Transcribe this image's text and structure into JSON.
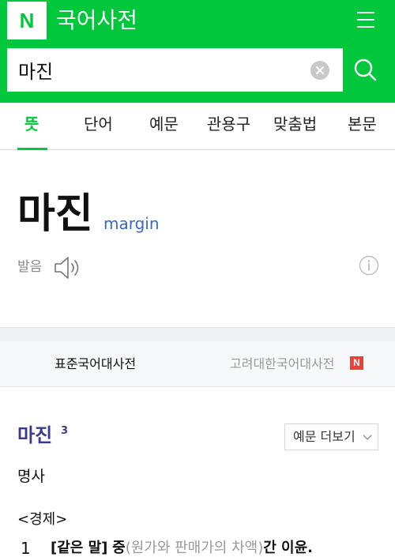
{
  "header": {
    "logo_text": "N",
    "title": "국어사전",
    "brand_color": "#00c73c",
    "menu_icon": "hamburger-icon"
  },
  "search": {
    "value": "마진",
    "placeholder": "",
    "clear_icon": "close-icon",
    "search_icon": "search-icon"
  },
  "tabs": [
    {
      "label": "뜻",
      "active": true
    },
    {
      "label": "단어",
      "active": false
    },
    {
      "label": "예문",
      "active": false
    },
    {
      "label": "관용구",
      "active": false
    },
    {
      "label": "맞춤법",
      "active": false
    },
    {
      "label": "본문",
      "active": false
    }
  ],
  "headword": {
    "word": "마진",
    "origin": "margin",
    "pronunciation_label": "발음",
    "speaker_icon": "speaker-icon",
    "info_icon": "info-icon"
  },
  "dictionaries": {
    "active": "표준국어대사전",
    "inactive": "고려대한국어대사전",
    "badge": "N",
    "badge_color": "#e8413b"
  },
  "entry": {
    "word": "마진",
    "homonym_number": "3",
    "more_examples_label": "예문 더보기",
    "part_of_speech": "명사",
    "field": "<경제>",
    "definitions": [
      {
        "number": "1",
        "tag": "[같은 말]",
        "word": "중",
        "gloss": "(원가와 판매가의 차액)",
        "rest": "간 이윤."
      }
    ]
  }
}
